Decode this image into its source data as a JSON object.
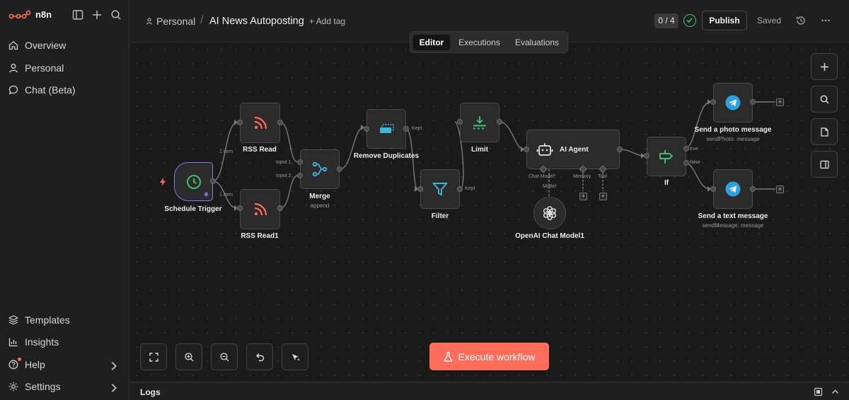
{
  "app": {
    "name": "n8n"
  },
  "sidebar": {
    "items": [
      {
        "label": "Overview"
      },
      {
        "label": "Personal"
      },
      {
        "label": "Chat (Beta)"
      }
    ],
    "bottom": [
      {
        "label": "Templates"
      },
      {
        "label": "Insights"
      },
      {
        "label": "Help"
      },
      {
        "label": "Settings"
      }
    ]
  },
  "header": {
    "breadcrumb_project": "Personal",
    "workflow_title": "AI News Autoposting",
    "add_tag": "+ Add tag",
    "counter": "0 / 4",
    "publish": "Publish",
    "saved": "Saved"
  },
  "tabs": [
    {
      "label": "Editor",
      "active": true
    },
    {
      "label": "Executions",
      "active": false
    },
    {
      "label": "Evaluations",
      "active": false
    }
  ],
  "nodes": {
    "schedule": {
      "label": "Schedule Trigger"
    },
    "rss1": {
      "label": "RSS Read"
    },
    "rss2": {
      "label": "RSS Read1"
    },
    "merge": {
      "label": "Merge",
      "sub": "append",
      "input1": "Input 1",
      "input2": "Input 2"
    },
    "dedupe": {
      "label": "Remove Duplicates",
      "out": "Kept"
    },
    "filter": {
      "label": "Filter",
      "out": "Kept"
    },
    "limit": {
      "label": "Limit"
    },
    "agent": {
      "label": "AI Agent",
      "chat_model": "Chat Model",
      "memory": "Memory",
      "tool": "Tool",
      "model": "Model"
    },
    "openai": {
      "label": "OpenAI Chat Model1"
    },
    "if": {
      "label": "If",
      "true": "true",
      "false": "false"
    },
    "photo": {
      "label": "Send a photo message",
      "sub": "sendPhoto: message"
    },
    "text": {
      "label": "Send a text message",
      "sub": "sendMessage: message"
    }
  },
  "edges": {
    "item1": "1 item",
    "item2": "1 item"
  },
  "canvas": {
    "execute": "Execute workflow"
  },
  "logs": {
    "title": "Logs"
  },
  "colors": {
    "accent": "#ff6d5a",
    "success": "#3fbf73",
    "telegram": "#2aa3e0",
    "node_icon_blue": "#3fb6d9",
    "rss": "#ff6d5a",
    "trigger_border": "#8e76e8"
  }
}
